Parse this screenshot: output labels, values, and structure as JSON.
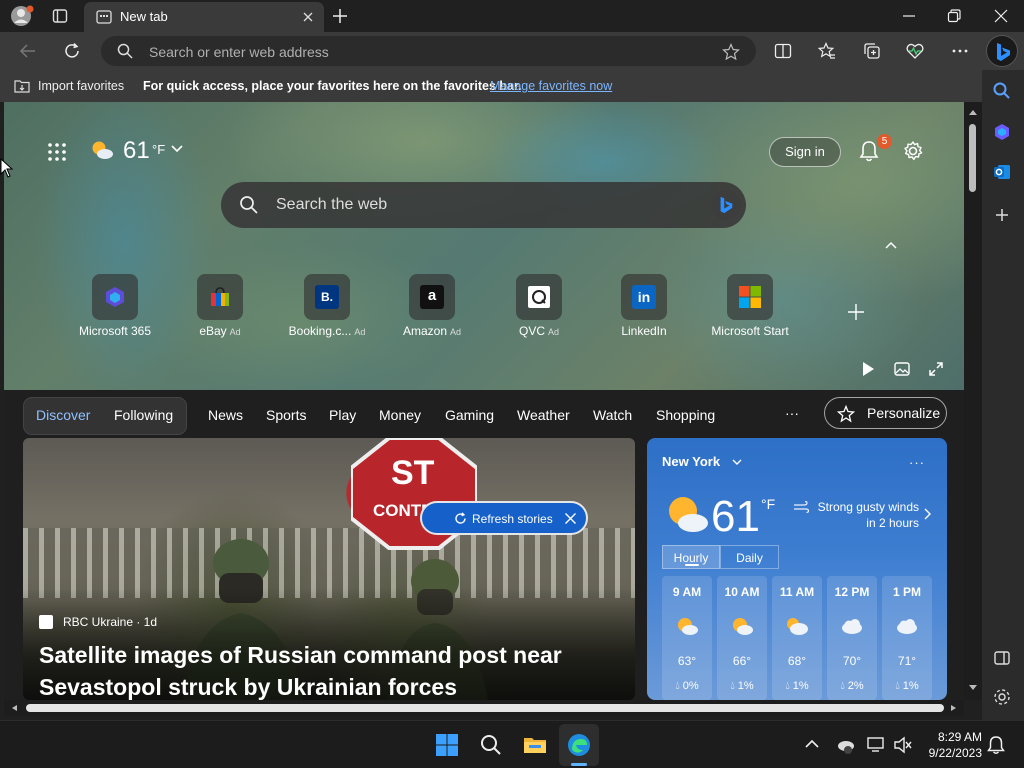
{
  "browser": {
    "tab_title": "New tab",
    "address_placeholder": "Search or enter web address"
  },
  "favorites_bar": {
    "import_label": "Import favorites",
    "hint": "For quick access, place your favorites here on the favorites bar.",
    "manage_link": "Manage favorites now"
  },
  "hero": {
    "temperature": "61",
    "unit": "°F",
    "sign_in": "Sign in",
    "notification_count": "5",
    "search_placeholder": "Search the web",
    "quick_links": [
      {
        "label": "Microsoft 365",
        "ad": ""
      },
      {
        "label": "eBay",
        "ad": "Ad"
      },
      {
        "label": "Booking.c...",
        "ad": "Ad"
      },
      {
        "label": "Amazon",
        "ad": "Ad"
      },
      {
        "label": "QVC",
        "ad": "Ad"
      },
      {
        "label": "LinkedIn",
        "ad": ""
      },
      {
        "label": "Microsoft Start",
        "ad": ""
      }
    ]
  },
  "feed_nav": {
    "discover": "Discover",
    "following": "Following",
    "items": [
      "News",
      "Sports",
      "Play",
      "Money",
      "Gaming",
      "Weather",
      "Watch",
      "Shopping"
    ],
    "more": "···",
    "personalize": "Personalize"
  },
  "story": {
    "sign_text": "ST\nCONTROL",
    "source": "RBC Ukraine · 1d",
    "title": "Satellite images of Russian command post near Sevastopol struck by Ukrainian forces",
    "refresh": "Refresh stories"
  },
  "weather": {
    "city": "New York",
    "more": "···",
    "temperature": "61",
    "unit": "°F",
    "alert": "Strong gusty winds in 2 hours",
    "tabs": [
      "Hourly",
      "Daily"
    ],
    "hours": [
      {
        "time": "9 AM",
        "icon": "partly-sunny-icon",
        "temp": "63°",
        "rain": "0%"
      },
      {
        "time": "10 AM",
        "icon": "partly-sunny-icon",
        "temp": "66°",
        "rain": "1%"
      },
      {
        "time": "11 AM",
        "icon": "mostly-cloudy-icon",
        "temp": "68°",
        "rain": "1%"
      },
      {
        "time": "12 PM",
        "icon": "cloudy-icon",
        "temp": "70°",
        "rain": "2%"
      },
      {
        "time": "1 PM",
        "icon": "cloudy-icon",
        "temp": "71°",
        "rain": "1%"
      }
    ]
  },
  "taskbar": {
    "time": "8:29 AM",
    "date": "9/22/2023"
  },
  "colors": {
    "accent": "#1560c9",
    "link": "#7cb6ff",
    "badge": "#e05a2b"
  }
}
